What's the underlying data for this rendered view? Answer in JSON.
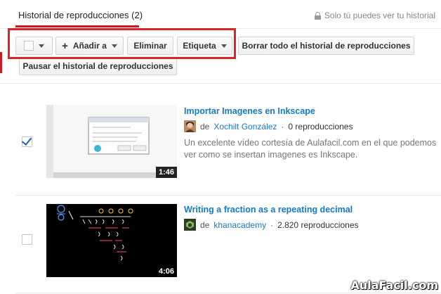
{
  "header": {
    "tab_title": "Historial de reproducciones (2)",
    "privacy_text": "Solo tú puedes ver tu historial"
  },
  "toolbar": {
    "add_to_label": "Añadir a",
    "delete_label": "Eliminar",
    "tag_label": "Etiqueta",
    "clear_all_label": "Borrar todo el historial de reproducciones",
    "pause_label": "Pausar el historial de reproducciones"
  },
  "videos": [
    {
      "title": "Importar Imagenes en Inkscape",
      "by": "de",
      "channel": "Xochilt González",
      "separator": "·",
      "views": "0 reproducciones",
      "description": "Un excelente vídeo cortesía de Aulafacil.com en el que podemos ver como se insertan imagenes es Inkscape.",
      "duration": "1:46",
      "checked": true
    },
    {
      "title": "Writing a fraction as a repeating decimal",
      "by": "de",
      "channel": "khanacademy",
      "separator": "·",
      "views": "2.820 reproducciones",
      "description": "",
      "duration": "4:06",
      "checked": false
    }
  ],
  "watermark": "AulaFacil.com",
  "colors": {
    "accent_red": "#cc181e",
    "link_blue": "#167ac6",
    "highlight_red": "#d9262b"
  }
}
